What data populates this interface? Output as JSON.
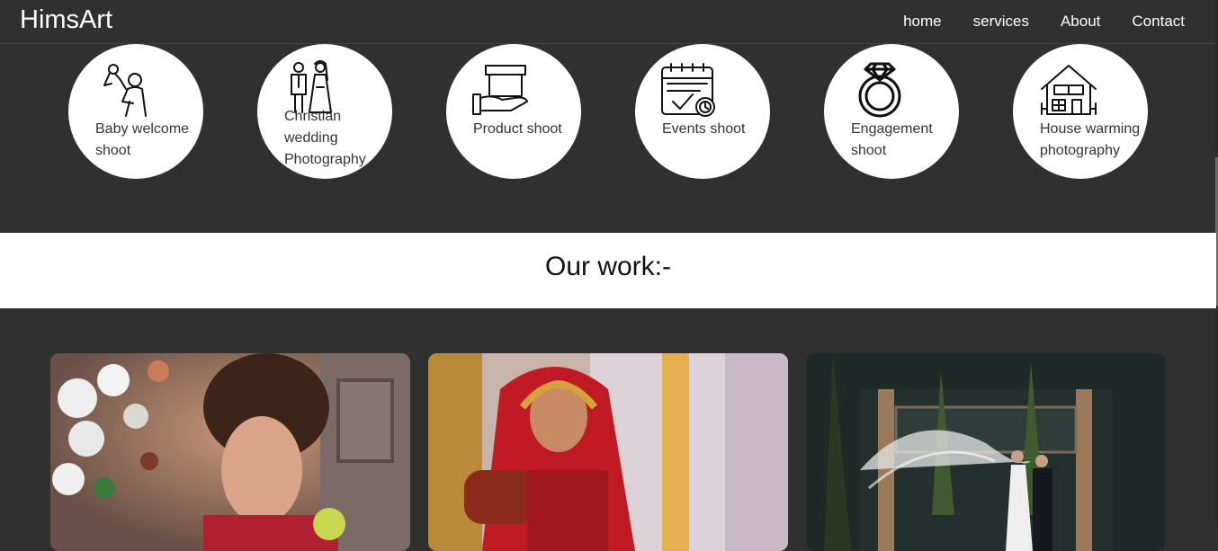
{
  "nav": {
    "brand": "HimsArt",
    "links": [
      "home",
      "services",
      "About",
      "Contact"
    ]
  },
  "services": [
    {
      "label": "Baby welcome shoot",
      "icon": "baby-icon"
    },
    {
      "label": "Christian wedding Photography",
      "icon": "wedding-couple-icon"
    },
    {
      "label": "Product shoot",
      "icon": "product-box-icon"
    },
    {
      "label": "Events shoot",
      "icon": "calendar-event-icon"
    },
    {
      "label": "Engagement shoot",
      "icon": "diamond-ring-icon"
    },
    {
      "label": "House warming photography",
      "icon": "house-icon"
    }
  ],
  "work": {
    "heading": "Our work:-",
    "photos": [
      "bride-portrait-photo",
      "red-dupatta-bride-photo",
      "couple-veil-photo"
    ]
  },
  "colors": {
    "background": "#303030",
    "section_white": "#ffffff",
    "icon_stroke": "#111111"
  }
}
